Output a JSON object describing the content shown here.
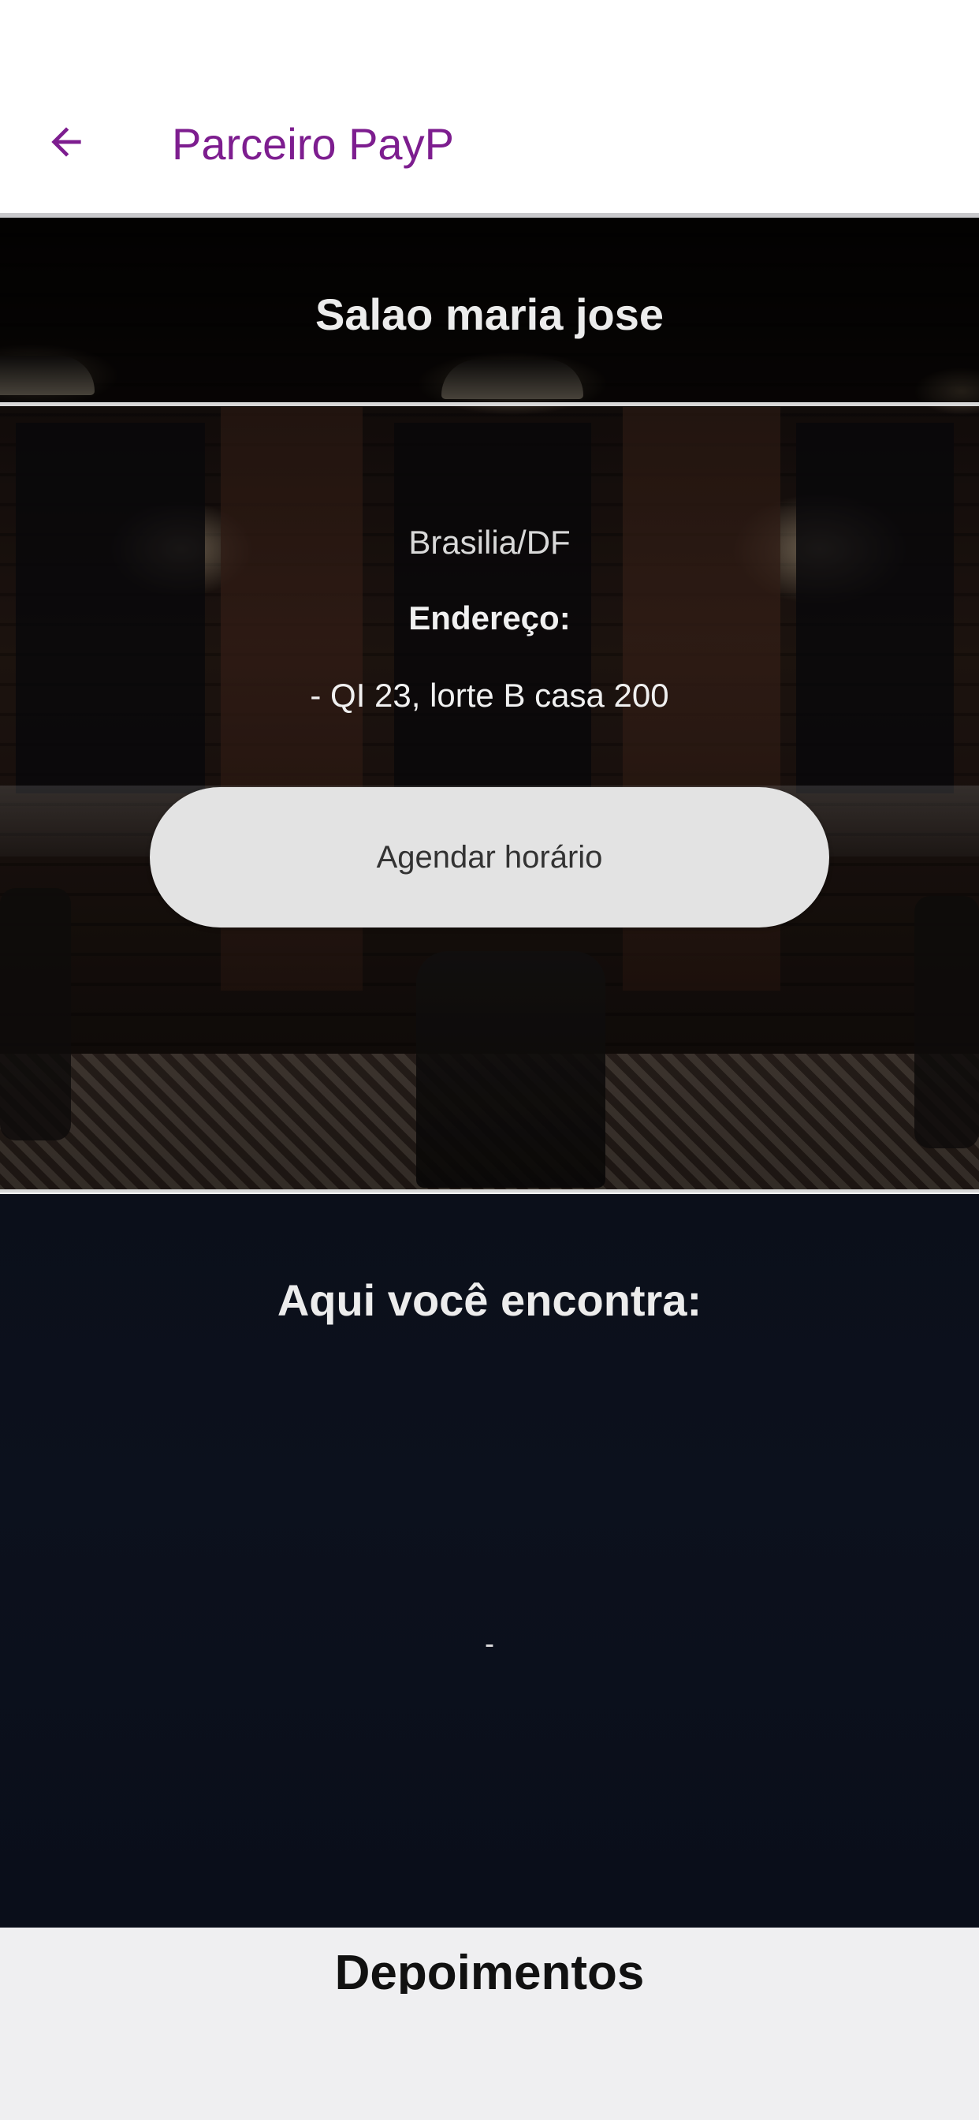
{
  "app_bar": {
    "title": "Parceiro PayP",
    "back_icon": "arrow-left-icon",
    "accent_color": "#7d1d8f"
  },
  "partner": {
    "name": "Salao maria jose",
    "city": "Brasilia/DF",
    "address_label": "Endereço:",
    "address": "- QI 23, lorte B casa 200",
    "schedule_button_label": "Agendar horário"
  },
  "services": {
    "title": "Aqui você encontra:",
    "content": "-"
  },
  "testimonials": {
    "title": "Depoimentos"
  }
}
